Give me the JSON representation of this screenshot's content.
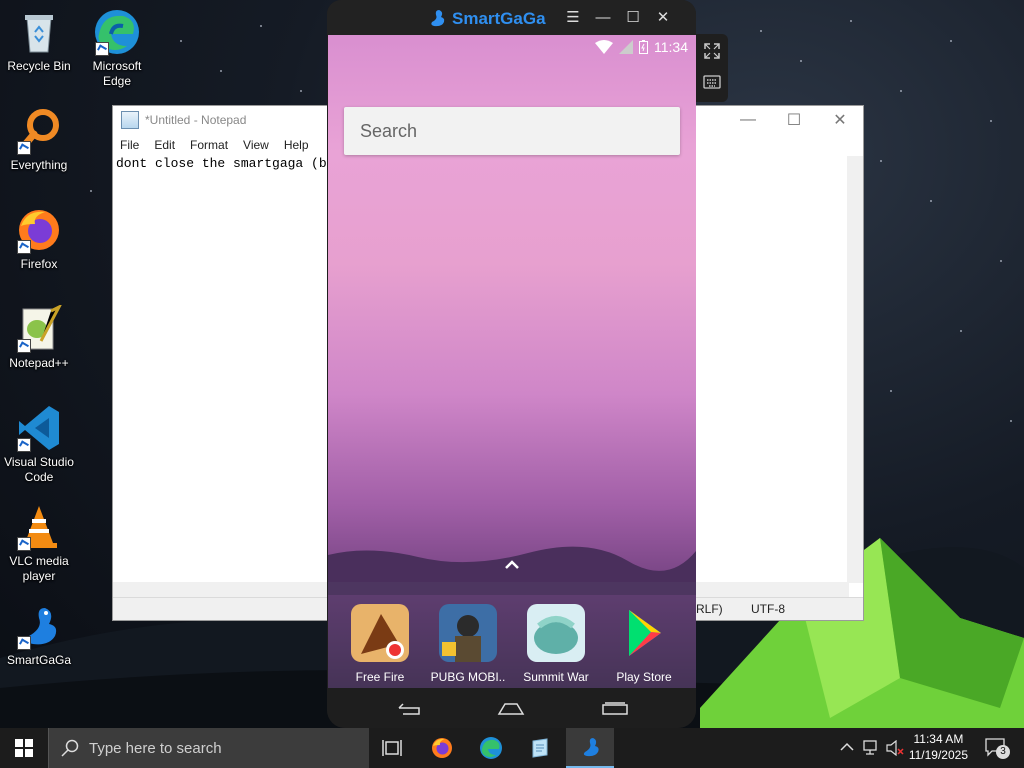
{
  "desktop": {
    "icons": [
      {
        "label": "Recycle Bin",
        "icon": "recycle-bin-icon"
      },
      {
        "label": "Microsoft Edge",
        "icon": "edge-icon"
      },
      {
        "label": "Everything",
        "icon": "everything-search-icon"
      },
      {
        "label": "Firefox",
        "icon": "firefox-icon"
      },
      {
        "label": "Notepad++",
        "icon": "notepad-plus-plus-icon"
      },
      {
        "label": "Visual Studio Code",
        "icon": "vscode-icon"
      },
      {
        "label": "VLC media player",
        "icon": "vlc-icon"
      },
      {
        "label": "SmartGaGa",
        "icon": "smartgaga-icon"
      }
    ]
  },
  "notepad": {
    "title": "*Untitled - Notepad",
    "menu": [
      "File",
      "Edit",
      "Format",
      "View",
      "Help"
    ],
    "content": "dont close the smartgaga (b",
    "status_line_ending": "RLF)",
    "status_encoding": "UTF-8"
  },
  "smartgaga": {
    "title": "SmartGaGa",
    "time": "11:34",
    "search_placeholder": "Search",
    "apps": [
      {
        "label": "Free Fire",
        "icon": "free-fire-icon"
      },
      {
        "label": "PUBG MOBI..",
        "icon": "pubg-mobile-icon"
      },
      {
        "label": "Summit War",
        "icon": "summit-war-icon"
      },
      {
        "label": "Play Store",
        "icon": "play-store-icon"
      }
    ]
  },
  "taskbar": {
    "search_placeholder": "Type here to search",
    "time": "11:34 AM",
    "date": "11/19/2025",
    "notifications": "3"
  }
}
